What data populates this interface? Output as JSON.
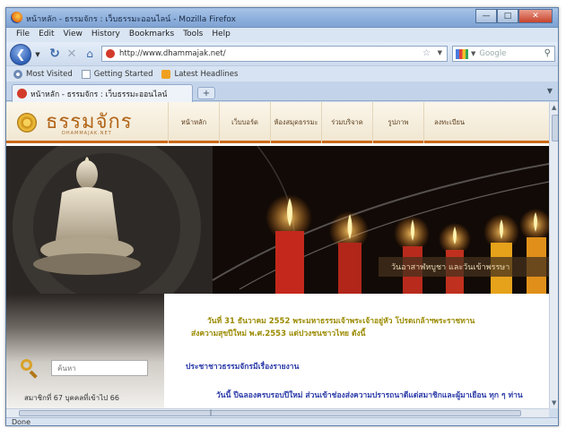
{
  "window": {
    "title": "หน้าหลัก - ธรรมจักร : เว็บธรรมะออนไลน์ - Mozilla Firefox"
  },
  "menu": [
    "File",
    "Edit",
    "View",
    "History",
    "Bookmarks",
    "Tools",
    "Help"
  ],
  "nav": {
    "url": "http://www.dhammajak.net/",
    "search_placeholder": "Google"
  },
  "bookmarks": [
    {
      "label": "Most Visited",
      "icon": "gear-icon"
    },
    {
      "label": "Getting Started",
      "icon": "page-icon"
    },
    {
      "label": "Latest Headlines",
      "icon": "rss-icon"
    }
  ],
  "tab": {
    "label": "หน้าหลัก - ธรรมจักร : เว็บธรรมะออนไลน์"
  },
  "site": {
    "logo": "ธรรมจักร",
    "logo_sub": "DHAMMAJAK.NET",
    "nav_items": [
      "หน้าหลัก",
      "เว็บบอร์ด",
      "ห้องสมุดธรรมะ",
      "ร่วมบริจาค",
      "รูปภาพ",
      "ลงทะเบียน"
    ],
    "banner_caption": "วันอาสาฬหบูชา และวันเข้าพรรษา",
    "search_placeholder": "ค้นหา",
    "members": "สมาชิกที่ 67 บุคคลที่เข้าไป 66",
    "news1_line1": "วันที่ 31 ธันวาคม 2552 พระมหาธรรมเจ้าพระเจ้าอยู่หัว โปรดเกล้าฯพระราชทาน",
    "news1_line2": "ส่งความสุขปีใหม่ พ.ศ.2553 แด่ปวงชนชาวไทย ดังนี้",
    "news_heading": "ประชาชาวธรรมจักรมีเรื่องรายงาน",
    "news2": "วันนี้ ปีฉลองครบรอบปีใหม่ ส่วนเข้าช่องส่งความปรารถนาดีแด่สมาชิกและผู้มาเยือน ทุก ๆ ท่าน"
  },
  "status": "Done",
  "colors": {
    "accent": "#c96a1b",
    "news_gold": "#9a8a00",
    "news_blue": "#2a3aa8"
  }
}
